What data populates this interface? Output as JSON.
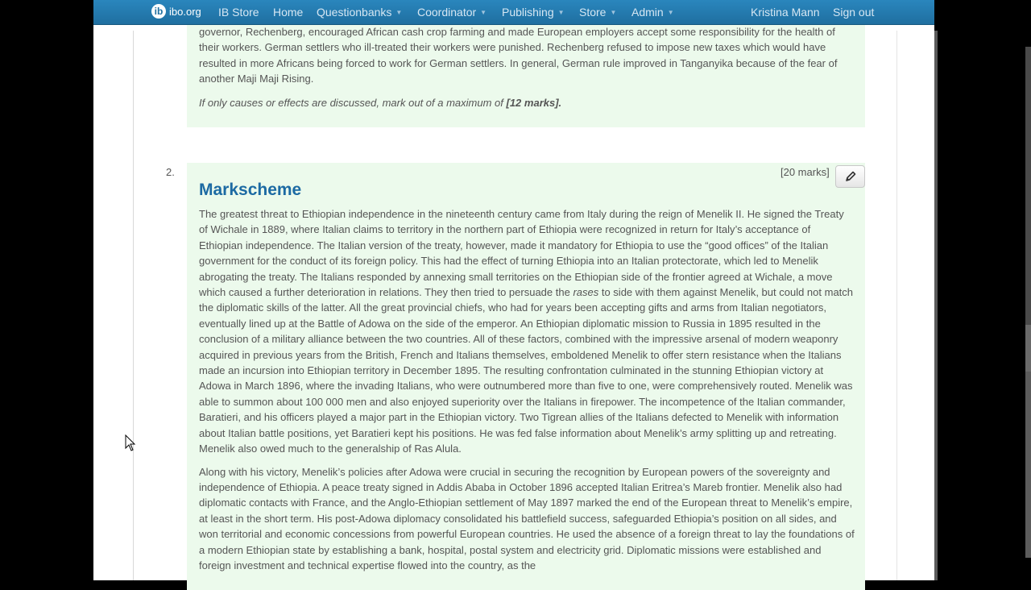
{
  "navbar": {
    "brand": "ibo.org",
    "brand_logo_letter": "ib",
    "items": [
      "IB Store",
      "Home",
      "Questionbanks",
      "Coordinator",
      "Publishing",
      "Store",
      "Admin"
    ],
    "user": "Kristina Mann",
    "signout": "Sign out"
  },
  "prev_markscheme": {
    "paragraph_start": "governor, Rechenberg, encouraged African cash crop farming and made European employers accept some responsibility for the health of their workers. German settlers who ill-treated their workers were punished. Rechenberg refused to impose new taxes which would have resulted in more Africans being forced to work for German settlers. In general, German rule improved in Tanganyika because of the fear of another Maji Maji Rising.",
    "note_text": "If only causes or effects are discussed, mark out of a maximum of ",
    "note_marks": "[12 marks]."
  },
  "question": {
    "number": "2.",
    "marks": "[20 marks]",
    "heading": "Markscheme",
    "para1_a": "The greatest threat to Ethiopian independence in the nineteenth century came from Italy during the reign of Menelik II. He signed the Treaty of Wichale in 1889, where Italian claims to territory in the northern part of Ethiopia were recognized in return for Italy’s acceptance of Ethiopian independence. The Italian version of the treaty, however, made it mandatory for Ethiopia to use the “good offices” of the Italian government for the conduct of its foreign policy. This had the effect of turning Ethiopia into an Italian protectorate, which led to Menelik abrogating the treaty. The Italians responded by annexing small territories on the Ethiopian side of the frontier agreed at Wichale, a move which caused a further deterioration in relations. They then tried to persuade the ",
    "para1_italic": "rases",
    "para1_b": " to side with them against Menelik, but could not match the diplomatic skills of the latter. All the great provincial chiefs, who had for years been accepting gifts and arms from Italian negotiators, eventually lined up at the Battle of Adowa on the side of the emperor. An Ethiopian diplomatic mission to Russia in 1895 resulted in the conclusion of a military alliance between the two countries. All of these factors, combined with the impressive arsenal of modern weaponry acquired in previous years from the British, French and Italians themselves, emboldened Menelik to offer stern resistance when the Italians made an incursion into Ethiopian territory in December 1895. The resulting confrontation culminated in the stunning Ethiopian victory at Adowa in March 1896, where the invading Italians, who were outnumbered more than five to one, were comprehensively routed. Menelik was able to summon about 100 000 men and also enjoyed superiority over the Italians in firepower. The incompetence of the Italian commander, Baratieri, and his officers played a major part in the Ethiopian victory. Two Tigrean allies of the Italians defected to Menelik with information about Italian battle positions, yet Baratieri kept his positions. He was fed false information about Menelik’s army splitting up and retreating. Menelik also owed much to the generalship of Ras Alula.",
    "para2": "Along with his victory, Menelik’s policies after Adowa were crucial in securing the recognition by European powers of the sovereignty and independence of Ethiopia. A peace treaty signed in Addis Ababa in October 1896 accepted Italian Eritrea’s Mareb frontier. Menelik also had diplomatic contacts with France, and the Anglo-Ethiopian settlement of May 1897 marked the end of the European threat to Menelik’s empire, at least in the short term. His post-Adowa diplomacy consolidated his battlefield success, safeguarded Ethiopia’s position on all sides, and won territorial and economic concessions from powerful European countries. He used the absence of a foreign threat to lay the foundations of a modern Ethiopian state by establishing a bank, hospital, postal system and electricity grid. Diplomatic missions were established and foreign investment and technical expertise flowed into the country, as the"
  },
  "colors": {
    "nav_bg": "#2a86bd",
    "panel_bg": "#ecfaec",
    "heading": "#1c6aa3"
  }
}
